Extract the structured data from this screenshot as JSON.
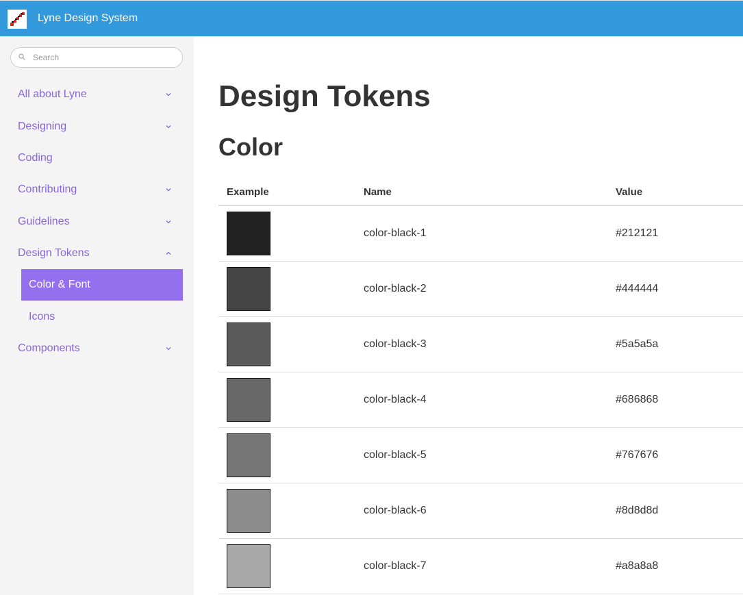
{
  "header": {
    "app_title": "Lyne Design System"
  },
  "search": {
    "placeholder": "Search",
    "value": ""
  },
  "sidebar": {
    "items": [
      {
        "label": "All about Lyne",
        "chevron": "down"
      },
      {
        "label": "Designing",
        "chevron": "down"
      },
      {
        "label": "Coding",
        "chevron": "none"
      },
      {
        "label": "Contributing",
        "chevron": "down"
      },
      {
        "label": "Guidelines",
        "chevron": "down"
      },
      {
        "label": "Design Tokens",
        "chevron": "up"
      },
      {
        "label": "Components",
        "chevron": "down"
      }
    ],
    "subitems": [
      {
        "label": "Color & Font",
        "active": true
      },
      {
        "label": "Icons",
        "active": false
      }
    ]
  },
  "main": {
    "page_title": "Design Tokens",
    "section_title": "Color",
    "table": {
      "headers": [
        "Example",
        "Name",
        "Value"
      ],
      "rows": [
        {
          "name": "color-black-1",
          "value": "#212121"
        },
        {
          "name": "color-black-2",
          "value": "#444444"
        },
        {
          "name": "color-black-3",
          "value": "#5a5a5a"
        },
        {
          "name": "color-black-4",
          "value": "#686868"
        },
        {
          "name": "color-black-5",
          "value": "#767676"
        },
        {
          "name": "color-black-6",
          "value": "#8d8d8d"
        },
        {
          "name": "color-black-7",
          "value": "#a8a8a8"
        }
      ]
    }
  },
  "colors": {
    "header_bg": "#3399dd",
    "nav_text": "#8866dd",
    "active_bg": "#9370ee",
    "sidebar_bg": "#f4f4f4"
  }
}
